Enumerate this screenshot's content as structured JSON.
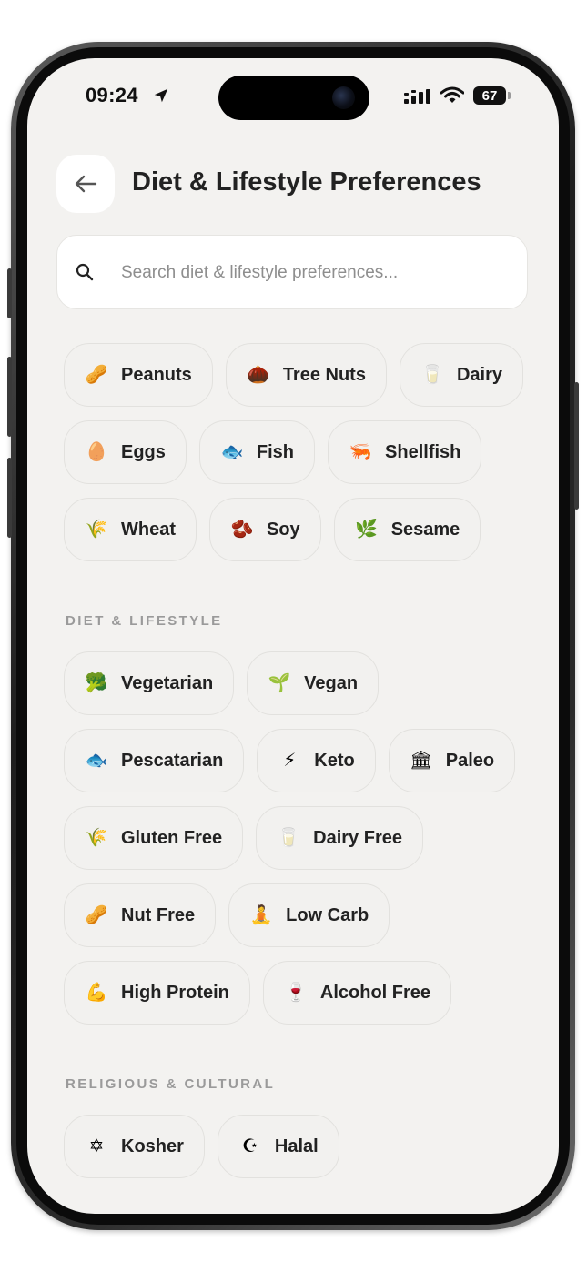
{
  "status_bar": {
    "time": "09:24",
    "battery": "67",
    "icons": [
      "location-arrow-icon",
      "signal-icon",
      "wifi-icon",
      "battery-icon"
    ]
  },
  "header": {
    "title": "Diet & Lifestyle Preferences",
    "back_icon": "arrow-left-icon"
  },
  "search": {
    "placeholder": "Search diet & lifestyle preferences...",
    "value": "",
    "icon": "search-icon"
  },
  "allergens": {
    "rows": [
      [
        {
          "label": "Peanuts",
          "icon": "🥜"
        },
        {
          "label": "Tree Nuts",
          "icon": "🌰"
        },
        {
          "label": "Dairy",
          "icon": "🥛"
        }
      ],
      [
        {
          "label": "Eggs",
          "icon": "🥚"
        },
        {
          "label": "Fish",
          "icon": "🐟"
        },
        {
          "label": "Shellfish",
          "icon": "🦐"
        }
      ],
      [
        {
          "label": "Wheat",
          "icon": "🌾"
        },
        {
          "label": "Soy",
          "icon": "🫘"
        },
        {
          "label": "Sesame",
          "icon": "🌿"
        }
      ]
    ]
  },
  "diet_lifestyle": {
    "heading": "DIET & LIFESTYLE",
    "rows": [
      [
        {
          "label": "Vegetarian",
          "icon": "🥦"
        },
        {
          "label": "Vegan",
          "icon": "🌱"
        }
      ],
      [
        {
          "label": "Pescatarian",
          "icon": "🐟"
        },
        {
          "label": "Keto",
          "icon": "⚡"
        },
        {
          "label": "Paleo",
          "icon": "🏛"
        }
      ],
      [
        {
          "label": "Gluten Free",
          "icon": "🌾"
        },
        {
          "label": "Dairy Free",
          "icon": "🥛"
        }
      ],
      [
        {
          "label": "Nut Free",
          "icon": "🥜"
        },
        {
          "label": "Low Carb",
          "icon": "🧘"
        }
      ],
      [
        {
          "label": "High Protein",
          "icon": "💪"
        },
        {
          "label": "Alcohol Free",
          "icon": "🍷"
        }
      ]
    ]
  },
  "religious_cultural": {
    "heading": "RELIGIOUS & CULTURAL",
    "rows": [
      [
        {
          "label": "Kosher",
          "icon": "✡"
        },
        {
          "label": "Halal",
          "icon": "☪"
        }
      ]
    ]
  }
}
